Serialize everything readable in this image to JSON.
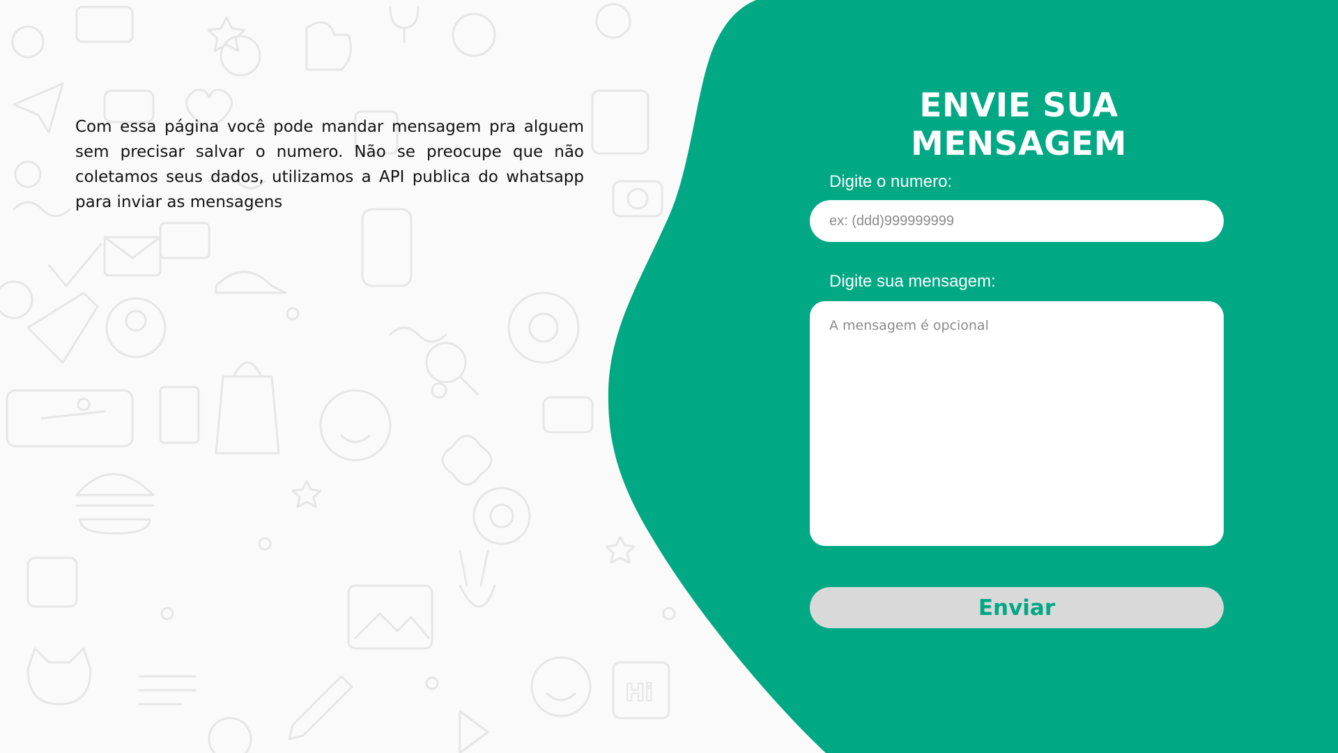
{
  "theme": {
    "accent": "#00a884",
    "background": "#fafafa",
    "doodle_color": "#e6e6e6",
    "button_background": "#d9d9d9"
  },
  "intro": {
    "text": "Com essa página você pode mandar mensagem pra alguem sem precisar salvar o numero. Não se preocupe que não coletamos seus dados, utilizamos a API publica do whatsapp para inviar as mensagens"
  },
  "form": {
    "title": "ENVIE SUA MENSAGEM",
    "number_label": "Digite o numero:",
    "number_placeholder": "ex: (ddd)999999999",
    "number_value": "",
    "message_label": "Digite sua mensagem:",
    "message_placeholder": "A mensagem é opcional",
    "message_value": "",
    "submit_label": "Enviar"
  },
  "background": {
    "pattern": "whatsapp-doodle-pattern",
    "doodle_text": "Hi"
  }
}
